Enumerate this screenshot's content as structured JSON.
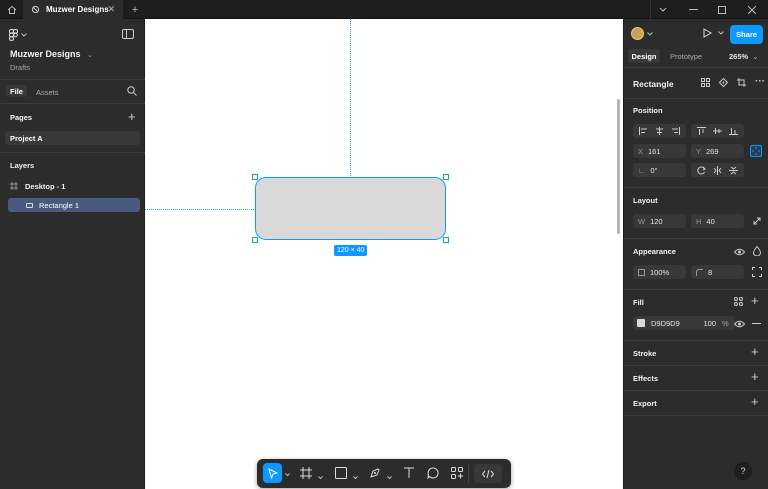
{
  "titlebar": {
    "tab_title": "Muzwer Designs"
  },
  "sidebar": {
    "project_name": "Muzwer Designs",
    "project_location": "Drafts",
    "tabs": [
      {
        "label": "File",
        "active": true
      },
      {
        "label": "Assets",
        "active": false
      }
    ],
    "pages_heading": "Pages",
    "pages": [
      "Project A"
    ],
    "layers_heading": "Layers",
    "layers": [
      {
        "label": "Desktop - 1",
        "type": "frame",
        "selected": false
      },
      {
        "label": "Rectangle 1",
        "type": "rectangle",
        "selected": true
      }
    ]
  },
  "canvas": {
    "size_badge": "120 × 40",
    "selection_color": "#0d99ff",
    "shape_fill": "#D9D9D9"
  },
  "inspector": {
    "share_label": "Share",
    "mode_tabs": [
      {
        "label": "Design",
        "active": true
      },
      {
        "label": "Prototype",
        "active": false
      }
    ],
    "zoom": "265%",
    "element_title": "Rectangle",
    "position_heading": "Position",
    "x_label": "X",
    "x_value": "161",
    "y_label": "Y",
    "y_value": "269",
    "rotation": "0°",
    "layout_heading": "Layout",
    "w_label": "W",
    "w_value": "120",
    "h_label": "H",
    "h_value": "40",
    "appearance_heading": "Appearance",
    "opacity": "100%",
    "radius": "8",
    "fill_heading": "Fill",
    "fill_hex": "D9D9D9",
    "fill_opacity": "100",
    "fill_opacity_unit": "%",
    "stroke_heading": "Stroke",
    "effects_heading": "Effects",
    "export_heading": "Export",
    "help_label": "?"
  },
  "toolbar": {
    "tools": [
      "move-tool",
      "frame-tool",
      "shape-tool",
      "pen-tool",
      "text-tool",
      "comment-tool",
      "actions-tool",
      "dev-mode-toggle"
    ],
    "active_tool": "move-tool"
  }
}
